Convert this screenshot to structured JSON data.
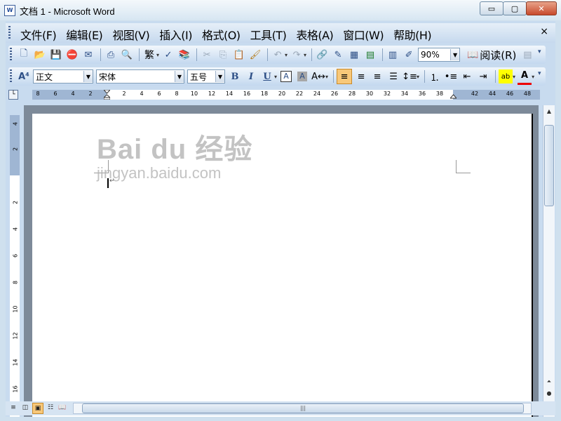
{
  "window": {
    "title": "文档 1 - Microsoft Word",
    "controls": {
      "minimize": "▭",
      "maximize": "▢",
      "close": "✕"
    }
  },
  "menubar": {
    "items": [
      "文件(F)",
      "编辑(E)",
      "视图(V)",
      "插入(I)",
      "格式(O)",
      "工具(T)",
      "表格(A)",
      "窗口(W)",
      "帮助(H)"
    ],
    "close_doc": "×"
  },
  "standard_toolbar": {
    "zoom": "90%",
    "read_label": "阅读(R)",
    "traditional_label": "繁"
  },
  "formatting_toolbar": {
    "style": "正文",
    "font": "宋体",
    "size": "五号",
    "bold": "B",
    "italic": "I",
    "underline": "U",
    "char_border": "A",
    "char_shading": "A",
    "font_color": "A"
  },
  "ruler": {
    "left_labels": [
      "8",
      "6",
      "4",
      "2"
    ],
    "right_labels": [
      "2",
      "4",
      "6",
      "8",
      "10",
      "12",
      "14",
      "16",
      "18",
      "20",
      "22",
      "24",
      "26",
      "28",
      "30",
      "32",
      "34",
      "36",
      "38"
    ],
    "margin_labels": [
      "42",
      "44",
      "46",
      "48"
    ],
    "vertical_labels": [
      "4",
      "2",
      "2",
      "4",
      "6",
      "8",
      "10",
      "12",
      "14",
      "16"
    ]
  },
  "watermark": {
    "main": "Bai du 经验",
    "sub": "jingyan.baidu.com"
  },
  "icons": [
    "new-icon",
    "open-icon",
    "save-icon",
    "permission-icon",
    "print-icon",
    "print-preview-icon",
    "research-icon",
    "spelling-icon",
    "cut-icon",
    "copy-icon",
    "paste-icon",
    "format-painter-icon",
    "undo-icon",
    "redo-icon",
    "hyperlink-icon",
    "tables-borders-icon",
    "insert-table-icon",
    "insert-excel-icon",
    "columns-icon",
    "drawing-icon",
    "styles-icon"
  ]
}
